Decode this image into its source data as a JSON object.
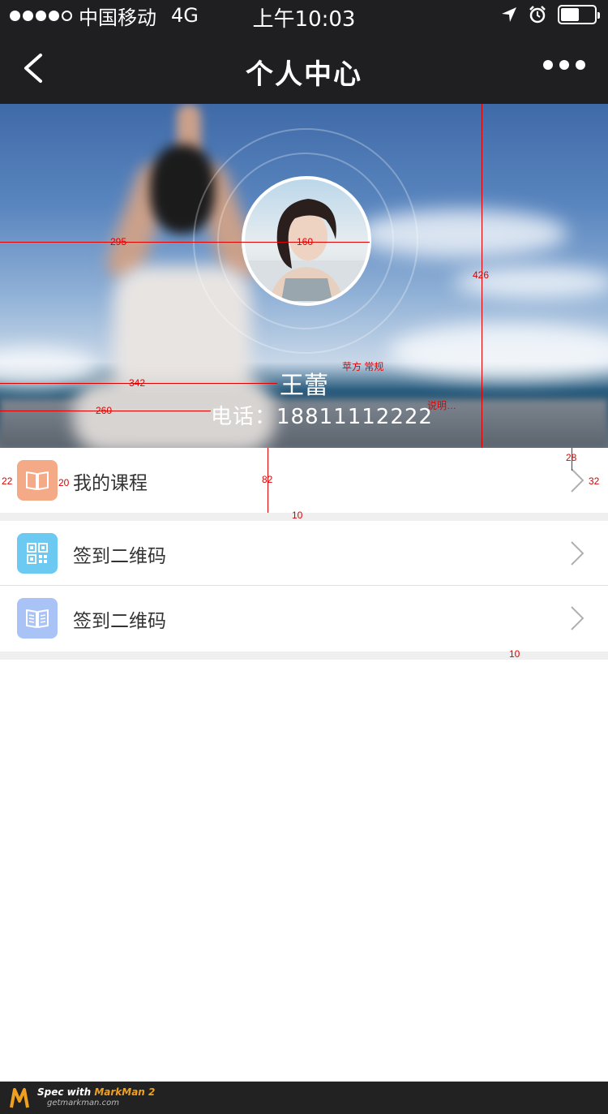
{
  "status_bar": {
    "carrier": "中国移动",
    "network": "4G",
    "time": "上午10:03",
    "battery_level": 0.55
  },
  "nav": {
    "title": "个人中心",
    "back_icon": "chevron-left-icon",
    "more_icon": "more-dots-icon"
  },
  "profile": {
    "name": "王蕾",
    "phone": "电话：18811112222"
  },
  "menu": {
    "items": [
      {
        "label": "我的课程",
        "icon": "book-icon",
        "icon_color": "#f4a987"
      },
      {
        "label": "签到二维码",
        "icon": "qr-code-icon",
        "icon_color": "#6cc9f2"
      },
      {
        "label": "签到二维码",
        "icon": "reading-icon",
        "icon_color": "#a9c3f6"
      }
    ]
  },
  "spec_annotations": {
    "dims": [
      "295",
      "160",
      "426",
      "342",
      "260",
      "28",
      "82",
      "22",
      "20",
      "32",
      "10",
      "10"
    ],
    "notes": [
      "苹方 常规",
      "说明…"
    ]
  },
  "watermark": {
    "title_prefix": "Spec with ",
    "title_accent": "MarkMan 2",
    "subtitle": "getmarkman.com"
  }
}
